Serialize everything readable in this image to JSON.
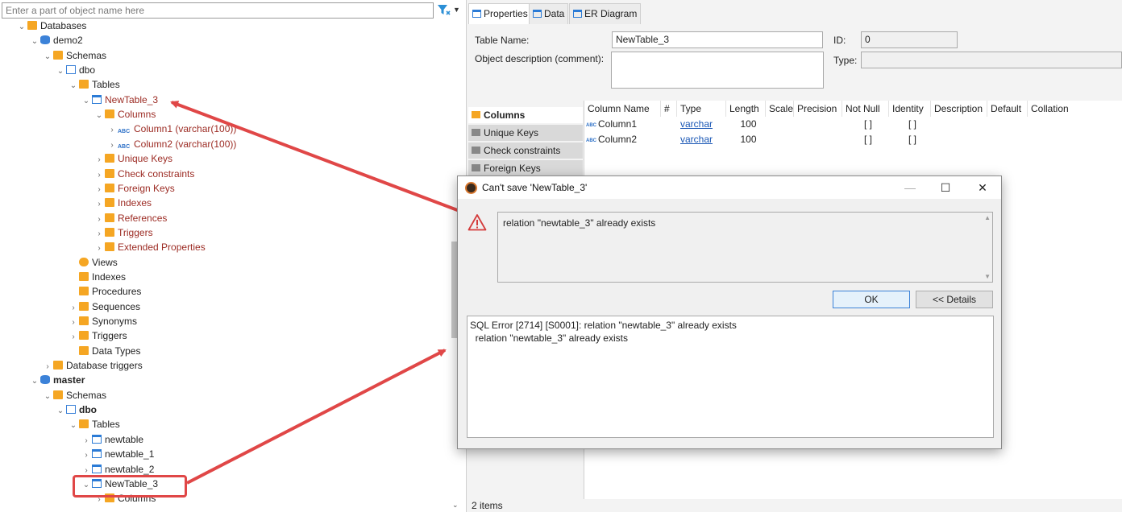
{
  "navigator": {
    "filter_placeholder": "Enter a part of object name here",
    "tree": [
      {
        "label": "Databases",
        "icon": "folder-icon",
        "level": 0,
        "expanded": true
      },
      {
        "label": "demo2",
        "icon": "database-icon",
        "level": 1,
        "expanded": true
      },
      {
        "label": "Schemas",
        "icon": "folder-icon",
        "level": 2,
        "expanded": true
      },
      {
        "label": "dbo",
        "icon": "schema-icon",
        "level": 3,
        "expanded": true
      },
      {
        "label": "Tables",
        "icon": "folder-icon",
        "level": 4,
        "expanded": true
      },
      {
        "label": "NewTable_3",
        "icon": "table-icon",
        "level": 5,
        "expanded": true,
        "style": "red"
      },
      {
        "label": "Columns",
        "icon": "folder-icon",
        "level": 6,
        "expanded": true,
        "style": "red"
      },
      {
        "label": "Column1 (varchar(100))",
        "icon": "column-abc-icon",
        "level": 7,
        "expanded": false,
        "style": "red"
      },
      {
        "label": "Column2 (varchar(100))",
        "icon": "column-abc-icon",
        "level": 7,
        "expanded": false,
        "style": "red"
      },
      {
        "label": "Unique Keys",
        "icon": "folder-icon",
        "level": 6,
        "expanded": false,
        "style": "red"
      },
      {
        "label": "Check constraints",
        "icon": "folder-icon",
        "level": 6,
        "expanded": false,
        "style": "red"
      },
      {
        "label": "Foreign Keys",
        "icon": "folder-icon",
        "level": 6,
        "expanded": false,
        "style": "red"
      },
      {
        "label": "Indexes",
        "icon": "folder-icon",
        "level": 6,
        "expanded": false,
        "style": "red"
      },
      {
        "label": "References",
        "icon": "folder-icon",
        "level": 6,
        "expanded": false,
        "style": "red"
      },
      {
        "label": "Triggers",
        "icon": "folder-icon",
        "level": 6,
        "expanded": false,
        "style": "red"
      },
      {
        "label": "Extended Properties",
        "icon": "folder-icon",
        "level": 6,
        "expanded": false,
        "style": "red"
      },
      {
        "label": "Views",
        "icon": "view-icon",
        "level": 4,
        "leaf": true
      },
      {
        "label": "Indexes",
        "icon": "folder-icon",
        "level": 4,
        "leaf": true
      },
      {
        "label": "Procedures",
        "icon": "folder-icon",
        "level": 4,
        "leaf": true
      },
      {
        "label": "Sequences",
        "icon": "folder-icon",
        "level": 4,
        "expanded": false
      },
      {
        "label": "Synonyms",
        "icon": "folder-icon",
        "level": 4,
        "expanded": false
      },
      {
        "label": "Triggers",
        "icon": "folder-icon",
        "level": 4,
        "expanded": false
      },
      {
        "label": "Data Types",
        "icon": "folder-icon",
        "level": 4,
        "leaf": true
      },
      {
        "label": "Database triggers",
        "icon": "folder-icon",
        "level": 2,
        "expanded": false
      },
      {
        "label": "master",
        "icon": "database-icon",
        "level": 1,
        "expanded": true,
        "style": "bold"
      },
      {
        "label": "Schemas",
        "icon": "folder-icon",
        "level": 2,
        "expanded": true
      },
      {
        "label": "dbo",
        "icon": "schema-icon",
        "level": 3,
        "expanded": true,
        "style": "bold"
      },
      {
        "label": "Tables",
        "icon": "folder-icon",
        "level": 4,
        "expanded": true
      },
      {
        "label": "newtable",
        "icon": "table-icon",
        "level": 5,
        "expanded": false
      },
      {
        "label": "newtable_1",
        "icon": "table-icon",
        "level": 5,
        "expanded": false
      },
      {
        "label": "newtable_2",
        "icon": "table-icon",
        "level": 5,
        "expanded": false
      },
      {
        "label": "NewTable_3",
        "icon": "table-icon",
        "level": 5,
        "expanded": true
      },
      {
        "label": "Columns",
        "icon": "folder-icon",
        "level": 6,
        "expanded": false
      }
    ]
  },
  "editor": {
    "tabs": [
      {
        "label": "Properties",
        "icon": "properties-icon",
        "active": true
      },
      {
        "label": "Data",
        "icon": "data-icon",
        "active": false
      },
      {
        "label": "ER Diagram",
        "icon": "er-diagram-icon",
        "active": false
      }
    ],
    "table_name_label": "Table Name:",
    "table_name_value": "NewTable_3",
    "description_label": "Object description (comment):",
    "id_label": "ID:",
    "id_value": "0",
    "type_label": "Type:",
    "side_items": [
      {
        "label": "Columns",
        "active": true
      },
      {
        "label": "Unique Keys",
        "active": false
      },
      {
        "label": "Check constraints",
        "active": false
      },
      {
        "label": "Foreign Keys",
        "active": false
      }
    ],
    "grid_headers": [
      "Column Name",
      "#",
      "Type",
      "Length",
      "Scale",
      "Precision",
      "Not Null",
      "Identity",
      "Description",
      "Default",
      "Collation"
    ],
    "grid_rows": [
      {
        "name": "Column1",
        "type": "varchar",
        "length": "100",
        "not_null": "[ ]",
        "identity": "[ ]"
      },
      {
        "name": "Column2",
        "type": "varchar",
        "length": "100",
        "not_null": "[ ]",
        "identity": "[ ]"
      }
    ],
    "status": "2 items"
  },
  "dialog": {
    "title": "Can't save 'NewTable_3'",
    "message": "relation \"newtable_3\" already exists",
    "ok_label": "OK",
    "details_label": "<< Details",
    "details_line1": "SQL Error [2714] [S0001]: relation \"newtable_3\" already exists",
    "details_line2": "  relation \"newtable_3\" already exists"
  },
  "colors": {
    "error_red": "#9c2b23",
    "annotation_red": "#e04747",
    "link_blue": "#1a57b5",
    "folder_orange": "#f5a623"
  }
}
